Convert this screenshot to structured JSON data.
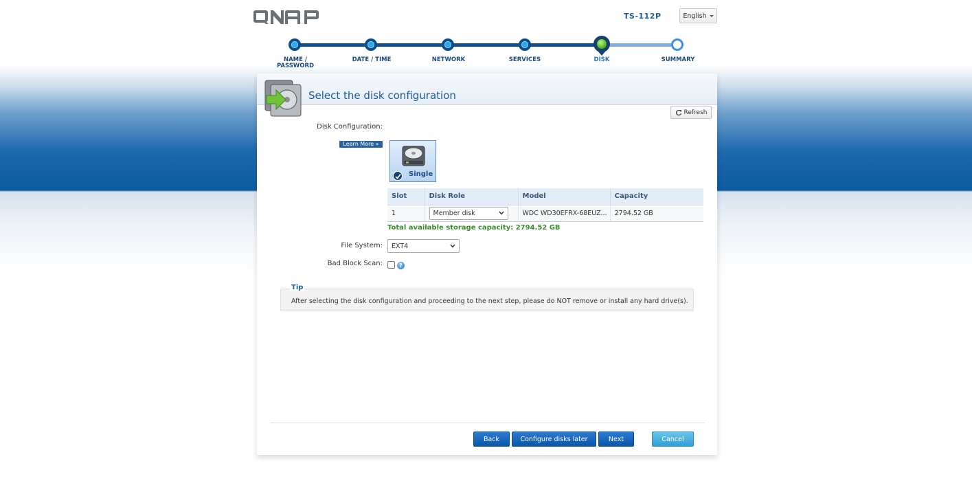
{
  "header": {
    "model": "TS-112P",
    "language": "English"
  },
  "steps": [
    {
      "label": "NAME /\nPASSWORD",
      "state": "done"
    },
    {
      "label": "DATE / TIME",
      "state": "done"
    },
    {
      "label": "NETWORK",
      "state": "done"
    },
    {
      "label": "SERVICES",
      "state": "done"
    },
    {
      "label": "DISK",
      "state": "active"
    },
    {
      "label": "SUMMARY",
      "state": "future"
    }
  ],
  "panel": {
    "title": "Select the disk configuration",
    "refresh_label": "Refresh",
    "disk_config_label": "Disk Configuration:",
    "learn_more_label": "Learn More »",
    "config_option": "Single",
    "table": {
      "columns": [
        "Slot",
        "Disk Role",
        "Model",
        "Capacity"
      ],
      "rows": [
        {
          "slot": "1",
          "role": "Member disk",
          "model": "WDC WD30EFRX-68EUZ...",
          "capacity": "2794.52 GB"
        }
      ]
    },
    "total_capacity": "Total available storage capacity: 2794.52 GB",
    "file_system_label": "File System:",
    "file_system_value": "EXT4",
    "bad_block_label": "Bad Block Scan:",
    "bad_block_checked": false,
    "tip_title": "Tip",
    "tip_text": "After selecting the disk configuration and proceeding to the next step, please do NOT remove or install any hard drive(s)."
  },
  "buttons": {
    "back": "Back",
    "configure_later": "Configure disks later",
    "next": "Next",
    "cancel": "Cancel"
  },
  "colors": {
    "accent": "#1d5a9a",
    "active_step": "#47b014",
    "capacity_text": "#3a8d2d",
    "primary_button": "#0b56a6",
    "cancel_button": "#2f9fd4"
  }
}
